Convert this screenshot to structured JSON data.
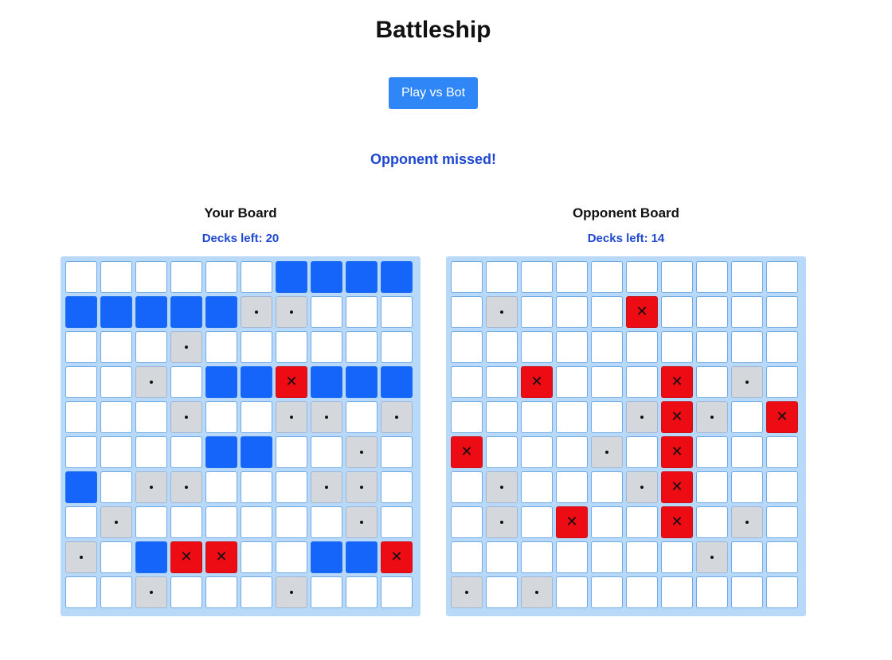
{
  "title": "Battleship",
  "play_button_label": "Play vs Bot",
  "status_message": "Opponent missed!",
  "colors": {
    "accent": "#2f86f6",
    "status_text": "#1e47d0",
    "board_bg": "#b9d9fb",
    "ship": "#1565fb",
    "miss": "#d4d7dc",
    "hit": "#ee0c14"
  },
  "cell_legend": {
    "E": "empty",
    "S": "ship",
    "M": "miss (dot)",
    "H": "hit (x)"
  },
  "icons": {
    "miss": "dot-icon",
    "hit": "x-icon"
  },
  "boards": {
    "player": {
      "title": "Your Board",
      "decks_label": "Decks left:",
      "decks_left": "20",
      "rows": [
        "EEEEEESSSS",
        "SSSSSMMEEE",
        "EEEMEEEEEE",
        "EEMESSHSSS",
        "EEEMEEMMEM",
        "EEEESSEEME",
        "SEMMEEEMME",
        "EMEEEEEEME",
        "MESHHEESSH",
        "EEMEEEMEEE"
      ]
    },
    "opponent": {
      "title": "Opponent Board",
      "decks_label": "Decks left:",
      "decks_left": "14",
      "rows": [
        "EEEEEEEEEE",
        "EMEEEHEEEE",
        "EEEEEEEEEE",
        "EEHEEEHEME",
        "EEEEEMHMEH",
        "HEEEMEHEEE",
        "EMEEEMHEEE",
        "EMEHEEHEME",
        "EEEEEEEMEE",
        "MEMEEEEEEE"
      ]
    }
  }
}
